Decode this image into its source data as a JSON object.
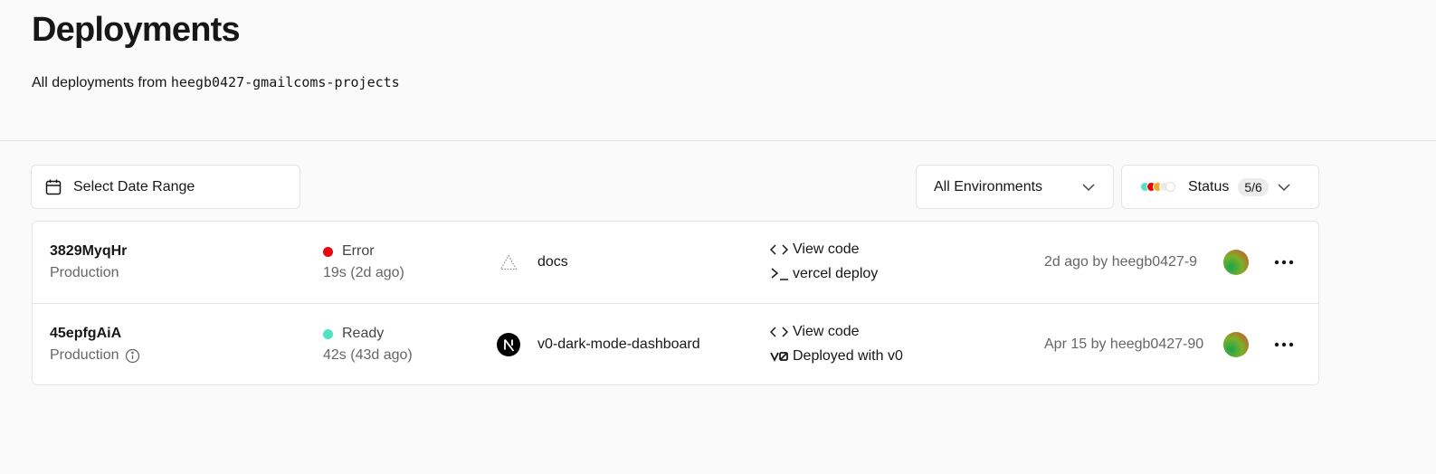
{
  "header": {
    "title": "Deployments",
    "subtitle_prefix": "All deployments from",
    "scope": "heegb0427-gmailcoms-projects"
  },
  "filters": {
    "date_range_label": "Select Date Range",
    "environment_label": "All Environments",
    "status_label": "Status",
    "status_count": "5/6",
    "status_dot_colors": [
      "#50e3c2",
      "#ee0000",
      "#f5a623",
      "#eaeaea",
      "#ffffff"
    ]
  },
  "deployments": [
    {
      "id": "3829MyqHr",
      "environment": "Production",
      "status": "Error",
      "status_color": "#e5080f",
      "duration": "19s (2d ago)",
      "project_icon": "triangle-outline-icon",
      "project": "docs",
      "code_link": "View code",
      "source_label": "vercel deploy",
      "source_icon": "terminal-icon",
      "byline": "2d ago by heegb0427-9"
    },
    {
      "id": "45epfgAiA",
      "environment": "Production",
      "status": "Ready",
      "status_color": "#50e3c2",
      "duration": "42s (43d ago)",
      "project_icon": "nextjs-icon",
      "project": "v0-dark-mode-dashboard",
      "code_link": "View code",
      "source_label": "Deployed with v0",
      "source_icon": "v0-icon",
      "byline": "Apr 15 by heegb0427-90"
    }
  ]
}
